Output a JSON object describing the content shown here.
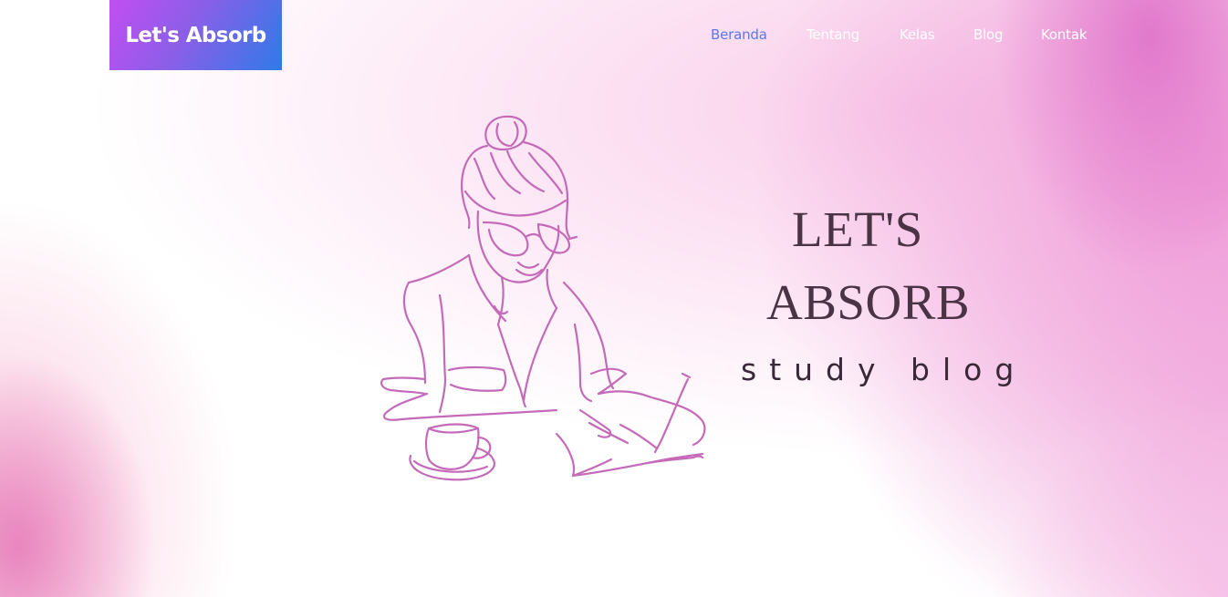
{
  "brand": {
    "name": "Let's Absorb",
    "gradient": [
      "#c24ef2",
      "#2f7ae8"
    ]
  },
  "nav": {
    "items": [
      {
        "label": "Beranda",
        "active": true
      },
      {
        "label": "Tentang",
        "active": false
      },
      {
        "label": "Kelas",
        "active": false
      },
      {
        "label": "Blog",
        "active": false
      },
      {
        "label": "Kontak",
        "active": false
      }
    ],
    "active_color": "#5a78e6"
  },
  "hero": {
    "title_line1": "LET'S",
    "title_line2": "ABSORB",
    "subtitle": "study blog",
    "illustration_icon": "woman-writing-line-art-icon",
    "illustration_color": "#c46ab8"
  }
}
